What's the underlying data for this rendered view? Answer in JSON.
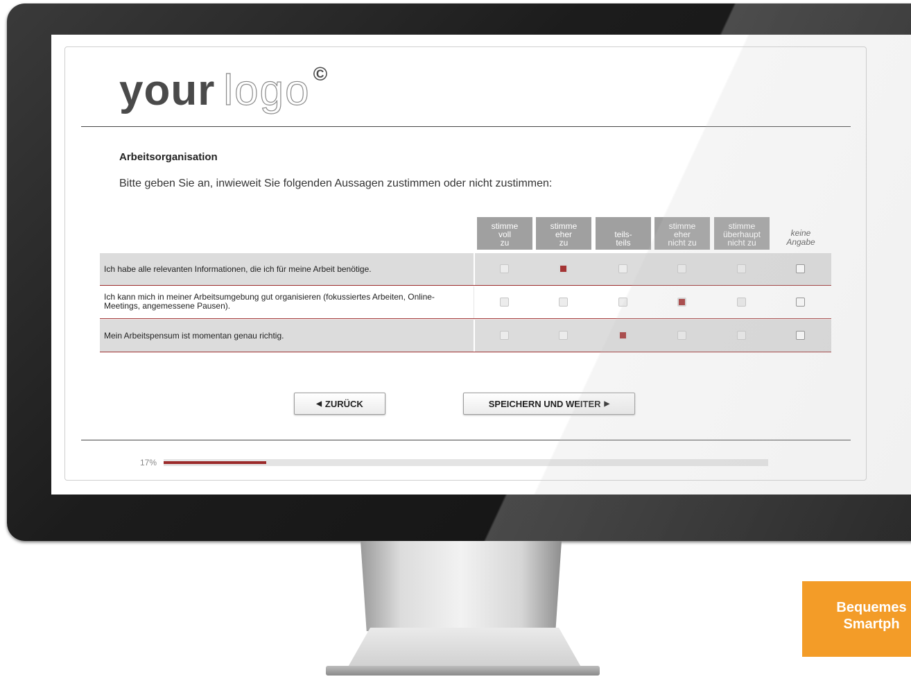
{
  "logo": {
    "part1": "your",
    "part2": "logo",
    "mark": "©"
  },
  "survey": {
    "section_title": "Arbeitsorganisation",
    "instruction": "Bitte geben Sie an, inwieweit Sie folgenden Aussagen zustimmen oder nicht zustimmen:",
    "scale": [
      {
        "l1": "stimme",
        "l2": "voll",
        "l3": "zu"
      },
      {
        "l1": "stimme",
        "l2": "eher",
        "l3": "zu"
      },
      {
        "l1": "",
        "l2": "teils-",
        "l3": "teils"
      },
      {
        "l1": "stimme",
        "l2": "eher",
        "l3": "nicht zu"
      },
      {
        "l1": "stimme",
        "l2": "überhaupt",
        "l3": "nicht zu"
      }
    ],
    "no_answer": {
      "l1": "keine",
      "l2": "Angabe"
    },
    "items": [
      {
        "text": "Ich habe alle relevanten Informationen, die ich für meine Arbeit benötige.",
        "selected": 1
      },
      {
        "text": "Ich kann mich in meiner Arbeitsumgebung gut organisieren (fokussiertes Arbeiten, Online-Meetings, angemessene Pausen).",
        "selected": 3
      },
      {
        "text": "Mein Arbeitspensum ist momentan genau richtig.",
        "selected": 2
      }
    ]
  },
  "nav": {
    "back_label": "ZURÜCK",
    "back_icon": "triangle-left-icon",
    "next_label": "SPEICHERN UND WEITER",
    "next_icon": "triangle-right-icon"
  },
  "progress": {
    "label": "17%",
    "value": 0.17
  },
  "badge": {
    "line1": "Bequemes",
    "line2": "Smartph"
  },
  "colors": {
    "accent": "#9b2a2a",
    "header_gray": "#a0a0a0",
    "badge": "#f39c28"
  }
}
